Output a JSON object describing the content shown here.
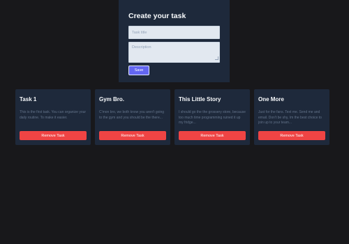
{
  "form": {
    "title": "Create your task",
    "title_placeholder": "Task title",
    "description_placeholder": "Description",
    "save_label": "Save"
  },
  "tasks": [
    {
      "title": "Task 1",
      "description": "This is the first task. You can organize your daily routine. To make it easier.",
      "remove_label": "Remove Task"
    },
    {
      "title": "Gym Bro.",
      "description": "C'mon bro, we both know you aren't going to the gym and you should be the there...",
      "remove_label": "Remove Task"
    },
    {
      "title": "This Little Story",
      "description": "I should go the the grossery store, because too much time programming ruined it up my fridge...",
      "remove_label": "Remove Task"
    },
    {
      "title": "One More",
      "description": "Just for the fans. Text me. Send me and email. Don't be shy, Im the best choice to join up to your team...",
      "remove_label": "Remove Task"
    }
  ],
  "colors": {
    "background": "#18181b",
    "card": "#1e293b",
    "accent": "#6366f1",
    "danger": "#ef4444"
  }
}
